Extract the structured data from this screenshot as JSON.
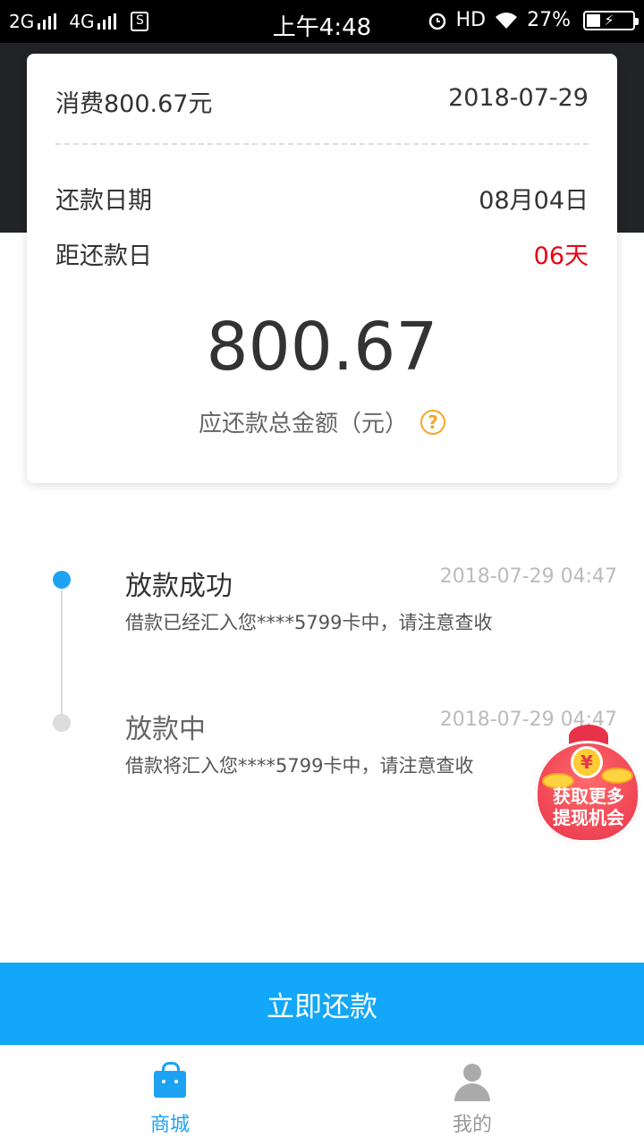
{
  "status_bar": {
    "network1": "2G",
    "network2": "4G",
    "sim_glyph": "S",
    "time": "上午4:48",
    "hd": "HD",
    "battery": "27%"
  },
  "card": {
    "consumption_label": "消费800.67元",
    "date": "2018-07-29",
    "repay_date_label": "还款日期",
    "repay_date_value": "08月04日",
    "days_left_label": "距还款日",
    "days_left_value": "06天",
    "total_amount": "800.67",
    "total_amount_label": "应还款总金额（元）"
  },
  "timeline": [
    {
      "title": "放款成功",
      "time": "2018-07-29 04:47",
      "desc": "借款已经汇入您****5799卡中，请注意查收",
      "active": true
    },
    {
      "title": "放款中",
      "time": "2018-07-29 04:47",
      "desc": "借款将汇入您****5799卡中，请注意查收",
      "active": false
    }
  ],
  "promo": {
    "coin_symbol": "¥",
    "line1": "获取更多",
    "line2": "提现机会"
  },
  "actions": {
    "repay_now": "立即还款"
  },
  "tabbar": {
    "items": [
      {
        "label": "商城",
        "icon": "shopping-bag-icon",
        "active": true
      },
      {
        "label": "我的",
        "icon": "person-icon",
        "active": false
      }
    ]
  },
  "colors": {
    "accent": "#12a7f8",
    "warning": "#e60012",
    "help": "#f5a623"
  }
}
